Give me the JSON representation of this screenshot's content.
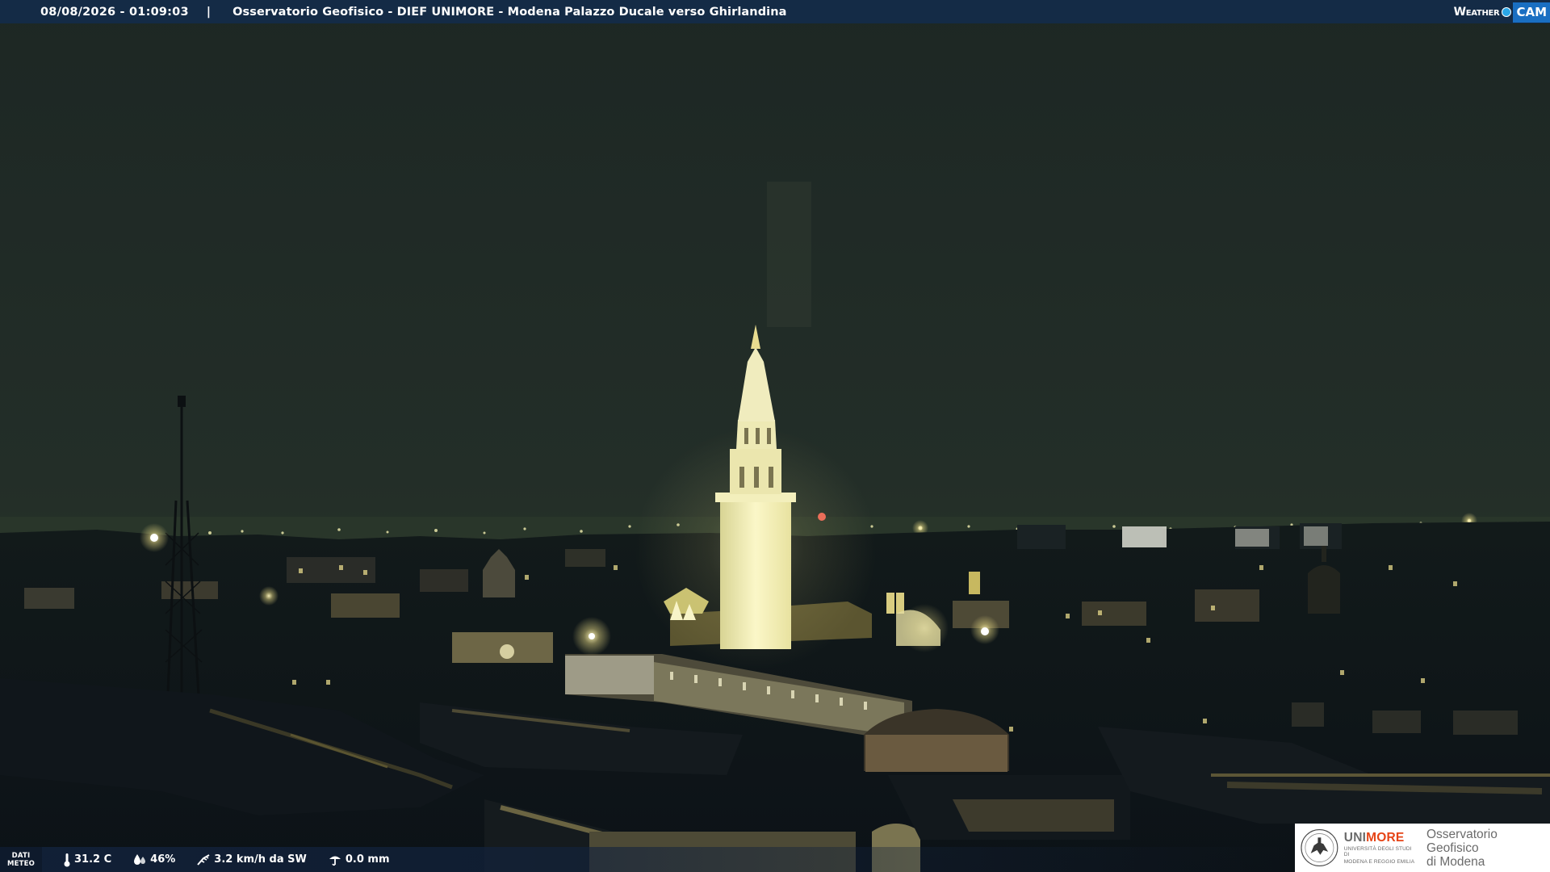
{
  "header": {
    "datetime": "08/08/2026 - 01:09:03",
    "separator": "|",
    "caption": "Osservatorio Geofisico - DIEF UNIMORE - Modena Palazzo Ducale verso Ghirlandina"
  },
  "brand": {
    "weather_text": "Weather",
    "cam_text": "CAM",
    "icon": "webcam-dot-icon"
  },
  "meteo": {
    "badge_line1": "DATI",
    "badge_line2": "METEO",
    "temperature": "31.2 C",
    "humidity": "46%",
    "wind": "3.2 km/h da SW",
    "rain": "0.0 mm",
    "icons": [
      "thermometer-icon",
      "humidity-drop-icon",
      "wind-icon",
      "rain-gauge-icon"
    ]
  },
  "logo": {
    "uni_part1": "UNI",
    "uni_part2": "MORE",
    "uni_subtitle_line1": "UNIVERSITÀ DEGLI STUDI DI",
    "uni_subtitle_line2": "MODENA E REGGIO EMILIA",
    "observatory_line1": "Osservatorio Geofisico",
    "observatory_line2": "di Modena",
    "icon": "university-seal-icon"
  },
  "colors": {
    "topbar": "#142b46",
    "sky": "#1e2a26",
    "tower_light": "#f4f0b0",
    "unimore_red": "#e64416"
  }
}
